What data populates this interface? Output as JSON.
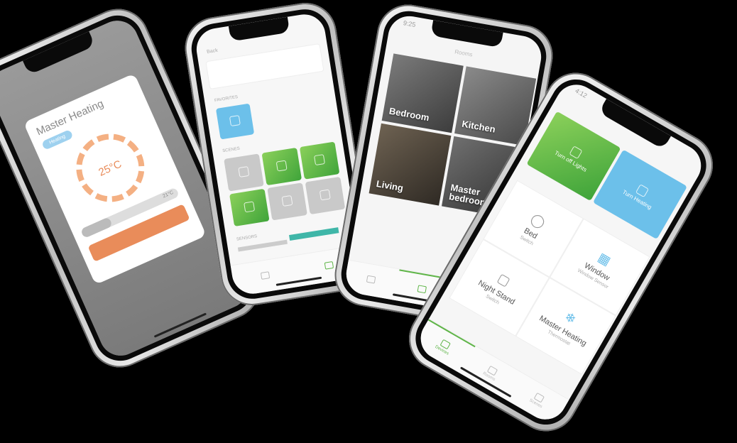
{
  "phone1": {
    "modal_title": "Master Heating",
    "mode_pill": "Heating",
    "temperature": "25°C",
    "slider_value": "21°C"
  },
  "phone2": {
    "back_label": "Back",
    "section_favorites": "FAVORITES",
    "section_scenes": "SCENES",
    "section_sensors": "SENSORS"
  },
  "phone3": {
    "time": "9:25",
    "header": "Rooms",
    "rooms": [
      {
        "name": "Bedroom"
      },
      {
        "name": "Kitchen"
      },
      {
        "name": "Living"
      },
      {
        "name": "Master bedroom"
      }
    ]
  },
  "phone4": {
    "time": "4:12",
    "scene_green": "Turn off Lights",
    "scene_blue": "Turn Heating",
    "devices": [
      {
        "name": "Bed",
        "sub": "Switch"
      },
      {
        "name": "Window",
        "sub": "Window Sensor"
      },
      {
        "name": "Night Stand",
        "sub": "Switch"
      },
      {
        "name": "Master Heating",
        "sub": "Thermostat"
      }
    ],
    "tabs": [
      "Devices",
      "Rooms",
      "Scenes"
    ]
  }
}
